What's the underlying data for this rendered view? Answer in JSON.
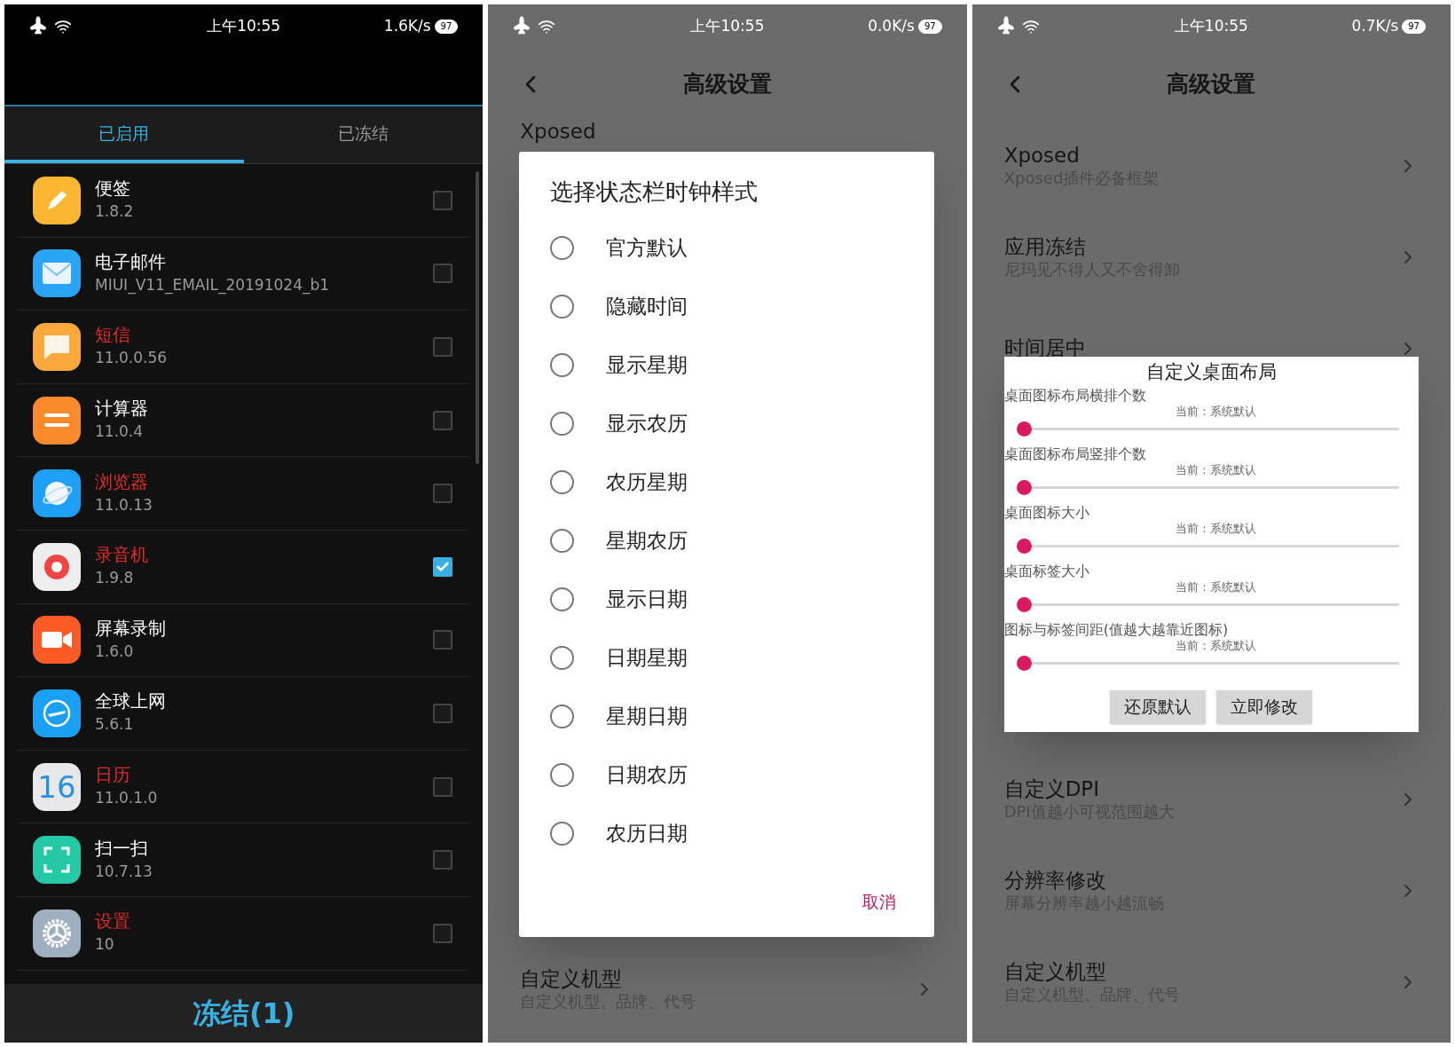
{
  "app_list_screen": {
    "status_bar": {
      "time": "上午10:55",
      "speed": "1.6K/s",
      "battery": "97"
    },
    "tabs": [
      {
        "label": "已启用",
        "selected": true
      },
      {
        "label": "已冻结",
        "selected": false
      }
    ],
    "apps": [
      {
        "name": "便签",
        "version": "1.8.2",
        "marked": false,
        "checked": false,
        "kind": "note"
      },
      {
        "name": "电子邮件",
        "version": "MIUI_V11_EMAIL_20191024_b1",
        "marked": false,
        "checked": false,
        "kind": "mail"
      },
      {
        "name": "短信",
        "version": "11.0.0.56",
        "marked": true,
        "checked": false,
        "kind": "message"
      },
      {
        "name": "计算器",
        "version": "11.0.4",
        "marked": false,
        "checked": false,
        "kind": "calculator"
      },
      {
        "name": "浏览器",
        "version": "11.0.13",
        "marked": true,
        "checked": false,
        "kind": "browser"
      },
      {
        "name": "录音机",
        "version": "1.9.8",
        "marked": true,
        "checked": true,
        "kind": "recorder"
      },
      {
        "name": "屏幕录制",
        "version": "1.6.0",
        "marked": false,
        "checked": false,
        "kind": "camera"
      },
      {
        "name": "全球上网",
        "version": "5.6.1",
        "marked": false,
        "checked": false,
        "kind": "plane"
      },
      {
        "name": "日历",
        "version": "11.0.1.0",
        "marked": true,
        "checked": false,
        "kind": "calendar",
        "icon_text": "16"
      },
      {
        "name": "扫一扫",
        "version": "10.7.13",
        "marked": false,
        "checked": false,
        "kind": "scan"
      },
      {
        "name": "设置",
        "version": "10",
        "marked": true,
        "checked": false,
        "kind": "settings"
      }
    ],
    "freeze_button": "冻结(1)"
  },
  "clock_style_screen": {
    "status_bar": {
      "time": "上午10:55",
      "speed": "0.0K/s",
      "battery": "97"
    },
    "title": "高级设置",
    "top_item": {
      "title": "Xposed"
    },
    "bottom_item": {
      "title": "自定义机型",
      "subtitle": "自定义机型、品牌、代号"
    },
    "dialog": {
      "title": "选择状态栏时钟样式",
      "options": [
        {
          "label": "官方默认",
          "selected": false
        },
        {
          "label": "隐藏时间",
          "selected": false
        },
        {
          "label": "显示星期",
          "selected": false
        },
        {
          "label": "显示农历",
          "selected": false
        },
        {
          "label": "农历星期",
          "selected": false
        },
        {
          "label": "星期农历",
          "selected": false
        },
        {
          "label": "显示日期",
          "selected": false
        },
        {
          "label": "日期星期",
          "selected": false
        },
        {
          "label": "星期日期",
          "selected": false
        },
        {
          "label": "日期农历",
          "selected": false
        },
        {
          "label": "农历日期",
          "selected": false
        }
      ],
      "cancel": "取消"
    }
  },
  "layout_screen": {
    "status_bar": {
      "time": "上午10:55",
      "speed": "0.7K/s",
      "battery": "97"
    },
    "title": "高级设置",
    "items_above": [
      {
        "title": "Xposed",
        "subtitle": "Xposed插件必备框架"
      },
      {
        "title": "应用冻结",
        "subtitle": "尼玛见不得人又不舍得卸"
      },
      {
        "title": "时间居中"
      }
    ],
    "items_below": [
      {
        "title": "自定义DPI",
        "subtitle": "DPI值越小可视范围越大"
      },
      {
        "title": "分辨率修改",
        "subtitle": "屏幕分辨率越小越流畅"
      },
      {
        "title": "自定义机型",
        "subtitle": "自定义机型、品牌、代号"
      }
    ],
    "dialog": {
      "title": "自定义桌面布局",
      "sliders": [
        {
          "label": "桌面图标布局横排个数",
          "reading": "当前：系统默认",
          "level": 0
        },
        {
          "label": "桌面图标布局竖排个数",
          "reading": "当前：系统默认",
          "level": 0
        },
        {
          "label": "桌面图标大小",
          "reading": "当前：系统默认",
          "level": 0
        },
        {
          "label": "桌面标签大小",
          "reading": "当前：系统默认",
          "level": 0
        },
        {
          "label": "图标与标签间距(值越大越靠近图标)",
          "reading": "当前：系统默认",
          "level": 0
        }
      ],
      "buttons": [
        "还原默认",
        "立即修改"
      ]
    }
  }
}
